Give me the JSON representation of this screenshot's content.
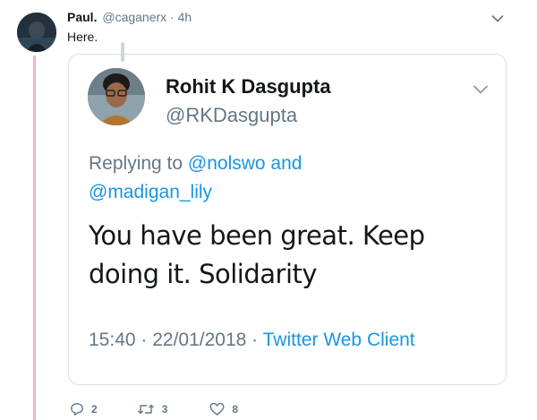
{
  "outer_tweet": {
    "author_name": "Paul.",
    "author_handle": "@caganerx",
    "separator": " · ",
    "time": "4h",
    "text": "Here.",
    "actions": {
      "reply_count": "2",
      "retweet_count": "3",
      "like_count": "8"
    }
  },
  "quoted_tweet": {
    "author_name": "Rohit K Dasgupta",
    "author_handle": "@RKDasgupta",
    "replying_prefix": "Replying to ",
    "reply_to_1": "@nolswo",
    "reply_joiner": " and ",
    "reply_to_2": "@madigan_lily",
    "text": "You have been great. Keep doing it. Solidarity",
    "time": "15:40",
    "date_separator": " · ",
    "date": "22/01/2018",
    "client_separator": " · ",
    "client": "Twitter Web Client"
  },
  "colors": {
    "link": "#1b95e0",
    "muted": "#657786",
    "thread_line": "#f4b8c4",
    "border": "#d7e0e6"
  },
  "icons": {
    "reply": "reply-icon",
    "retweet": "retweet-icon",
    "like": "heart-icon",
    "caret": "chevron-down-icon"
  }
}
